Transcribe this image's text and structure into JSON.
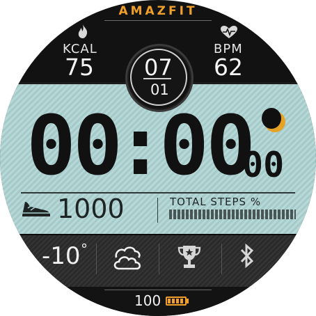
{
  "brand": "AMAZFIT",
  "metrics": {
    "kcal": {
      "label": "KCAL",
      "value": "75",
      "icon": "flame-icon"
    },
    "bpm": {
      "label": "BPM",
      "value": "62",
      "icon": "heart-pulse-icon"
    }
  },
  "date": {
    "month": "07",
    "day": "01"
  },
  "time": {
    "hours": "00",
    "separator": ":",
    "minutes": "00",
    "seconds": "00",
    "icon": "moon-icon"
  },
  "steps": {
    "value": "1000",
    "label": "TOTAL STEPS %",
    "progress_fraction": 1.0,
    "icon": "shoe-icon"
  },
  "status_strip": {
    "temperature": "-10",
    "temperature_unit": "°",
    "weather_icon": "cloud-icon",
    "trophy_icon": "trophy-icon",
    "bluetooth_icon": "bluetooth-icon"
  },
  "battery": {
    "value": "100",
    "icon": "battery-icon",
    "level_fraction": 1.0
  },
  "colors": {
    "accent": "#f0a02a",
    "panel": "#a9d0d0",
    "dark": "#121212"
  }
}
